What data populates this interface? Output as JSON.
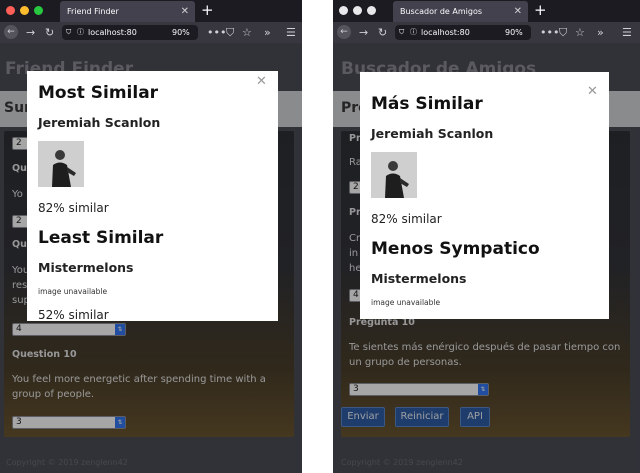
{
  "colors": {
    "accent": "#3478f6",
    "button": "#2e5fa7",
    "dot_red": "#fe5f57",
    "dot_yellow": "#febc2e",
    "dot_green": "#28c840"
  },
  "left": {
    "tab_title": "Friend Finder",
    "url": "localhost:80",
    "zoom": "90%",
    "app_title": "Friend Finder",
    "survey_heading": "Sur",
    "rows": [
      {
        "value": "2"
      },
      {
        "question": "Qu",
        "text": "Yo"
      },
      {
        "value": "2"
      },
      {
        "question": "Qu",
        "text_lines": [
          "You",
          "res",
          "sup"
        ]
      },
      {
        "value": "4"
      }
    ],
    "question10": {
      "label": "Question 10",
      "text": "You feel more energetic after spending time with a group of people.",
      "value": "3"
    },
    "footer": "Copyright © 2019 zenglenn42",
    "modal": {
      "most_title": "Most Similar",
      "most_name": "Jeremiah Scanlon",
      "most_pct": "82% similar",
      "least_title": "Least Similar",
      "least_name": "Mistermelons",
      "least_img": "image unavailable",
      "least_pct": "52% similar"
    }
  },
  "right": {
    "tab_title": "Buscador de Amigos",
    "url": "localhost:80",
    "zoom": "90%",
    "app_title": "Buscador de Amigos",
    "survey_heading": "Pre",
    "rows": [
      {
        "question": "Pr",
        "text": "Ra"
      },
      {
        "value": "2"
      },
      {
        "question": "Pr",
        "text_lines": [
          "Cr",
          "in",
          "he"
        ]
      },
      {
        "value": "4"
      }
    ],
    "question10": {
      "label": "Pregunta 10",
      "text": "Te sientes más enérgico después de pasar tiempo con un grupo de personas.",
      "value": "3"
    },
    "buttons": {
      "submit": "Enviar",
      "reset": "Reiniciar",
      "api": "API"
    },
    "footer": "Copyright © 2019 zenglenn42",
    "modal": {
      "most_title": "Más Similar",
      "most_name": "Jeremiah Scanlon",
      "most_pct": "82% similar",
      "least_title": "Menos Sympatico",
      "least_name": "Mistermelons",
      "least_img": "image unavailable"
    }
  }
}
